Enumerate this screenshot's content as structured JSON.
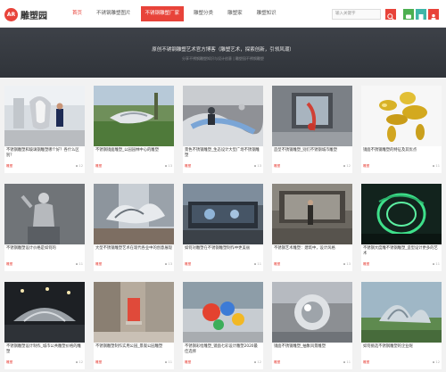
{
  "header": {
    "logo_badge": "AR",
    "logo_text": "雕塑园",
    "nav": [
      "首页",
      "不锈钢雕塑图片",
      "不锈钢雕塑厂家",
      "雕塑分类",
      "雕塑家",
      "雕塑知识"
    ],
    "search_placeholder": "输入关键字",
    "colors": {
      "accent": "#e8433a",
      "green": "#4caf50",
      "teal": "#3fb6a8"
    }
  },
  "banner": {
    "title": "原创不锈钢雕塑艺术官方博客（雕塑艺术，探索创新，引领风潮）",
    "subtitle": "分享不锈钢雕塑知识与设计创意  |  雕塑园不锈钢雕塑"
  },
  "cards": [
    {
      "title": "不锈钢雕塑和玻璃钢雕塑哪个好？各什么区别？",
      "tag": "雕塑",
      "count": "▪ 12"
    },
    {
      "title": "不锈钢镜面雕塑_公园园林中心的雕塑",
      "tag": "雕塑",
      "count": "▪ 13"
    },
    {
      "title": "景色不锈钢雕塑_生态设计大型广场不锈钢雕塑",
      "tag": "雕塑",
      "count": "▪ 13"
    },
    {
      "title": "造型不锈钢雕塑_别们不锈钢城市雕塑",
      "tag": "雕塑",
      "count": "▪ 12"
    },
    {
      "title": "镜面不锈钢雕塑的特征及其优点",
      "tag": "雕塑",
      "count": "▪ 11"
    },
    {
      "title": "不锈钢雕塑设计价格是如何的",
      "tag": "雕塑",
      "count": "▪ 11"
    },
    {
      "title": "大型不锈钢雕塑艺术在现代各业中的创意展现",
      "tag": "雕塑",
      "count": "▪ 13"
    },
    {
      "title": "如何对雕塑在不锈钢雕塑制作中更美丽",
      "tag": "雕塑",
      "count": "▪ 11"
    },
    {
      "title": "不锈钢艺术雕塑：建筑中，设计风格",
      "tag": "雕塑",
      "count": "▪ 13"
    },
    {
      "title": "不锈钢大度雕不锈钢雕塑_造型设计更多的艺术",
      "tag": "雕塑",
      "count": "▪ 11"
    },
    {
      "title": "不锈钢雕塑设计制作_城市公共雕塑价格的雕塑",
      "tag": "雕塑",
      "count": "▪ 12"
    },
    {
      "title": "不锈钢雕塑制作实用公园_景观公园雕塑",
      "tag": "雕塑",
      "count": "▪ 11"
    },
    {
      "title": "不锈钢彩绘雕塑_镜面七彩设计雕塑2020最佳选择",
      "tag": "雕塑",
      "count": "▪ 12"
    },
    {
      "title": "镜面不锈钢雕塑_抽象风景雕塑",
      "tag": "雕塑",
      "count": "▪ 11"
    },
    {
      "title": "如何挑选不锈钢雕塑的企业呢",
      "tag": "雕塑",
      "count": "▪ 12"
    }
  ]
}
